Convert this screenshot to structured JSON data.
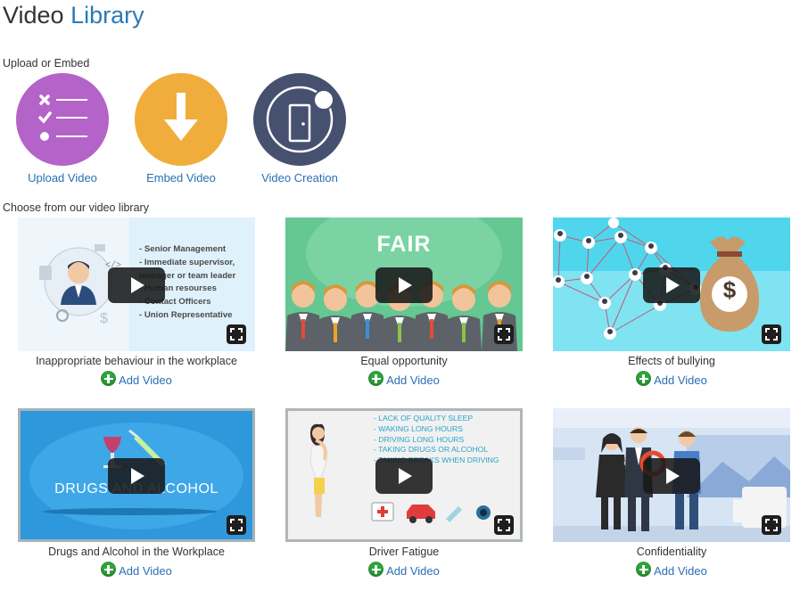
{
  "header": {
    "title_part1": "Video",
    "title_part2": "Library"
  },
  "upload_section": {
    "label": "Upload or Embed",
    "items": [
      {
        "label": "Upload Video",
        "icon": "checklist-icon",
        "color": "#b463c8"
      },
      {
        "label": "Embed Video",
        "icon": "download-arrow-icon",
        "color": "#f0ad3c"
      },
      {
        "label": "Video Creation",
        "icon": "door-icon",
        "color": "#465170"
      }
    ]
  },
  "library_section": {
    "label": "Choose from our video library",
    "add_label": "Add Video",
    "videos": [
      {
        "title": "Inappropriate behaviour in the workplace",
        "thumb_lines": [
          "- Senior Management",
          "- Immediate supervisor,",
          "manager or team leader",
          "- Human resourses",
          "- Contact Officers",
          "- Union Representative"
        ]
      },
      {
        "title": "Equal opportunity",
        "thumb_text": "FAIR"
      },
      {
        "title": "Effects of bullying",
        "thumb_symbol": "$"
      },
      {
        "title": "Drugs and Alcohol in the Workplace",
        "thumb_text": "DRUGS AND ALCOHOL"
      },
      {
        "title": "Driver Fatigue",
        "thumb_lines": [
          "- LACK OF QUALITY SLEEP",
          "- WAKING LONG HOURS",
          "- DRIVING LONG HOURS",
          "- TAKING DRUGS OR ALCOHOL",
          "- TAKING BREAKS WHEN DRIVING"
        ]
      },
      {
        "title": "Confidentiality"
      }
    ]
  }
}
